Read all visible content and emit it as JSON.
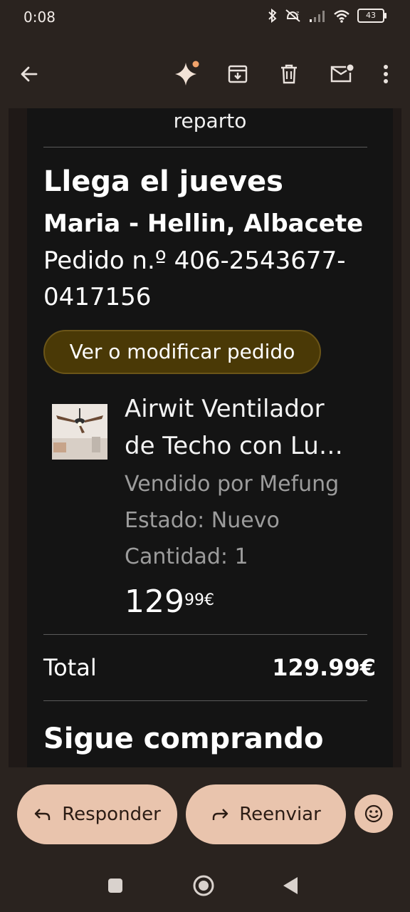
{
  "status_bar": {
    "time": "0:08",
    "battery": "43",
    "icons": [
      "bluetooth-icon",
      "dnd-icon",
      "signal-icon",
      "wifi-icon",
      "battery-icon"
    ]
  },
  "toolbar": {
    "icons": [
      "back-arrow-icon",
      "sparkle-icon",
      "archive-icon",
      "delete-icon",
      "mark-unread-icon",
      "more-vert-icon"
    ]
  },
  "email": {
    "reparto_text": "reparto",
    "arrival": "Llega el jueves",
    "recipient": "Maria - Hellin, Albacete",
    "order_line1": "Pedido n.º 406-2543677-",
    "order_line2": "0417156",
    "view_order_button": "Ver o modificar pedido",
    "product": {
      "title_line1": "Airwit Ventilador",
      "title_line2": "de Techo con Lu…",
      "seller": "Vendido por Mefung",
      "condition": "Estado: Nuevo",
      "quantity": "Cantidad: 1",
      "price_main": "129",
      "price_sup": "99€"
    },
    "total_label": "Total",
    "total_value": "129.99€",
    "keep_shopping": "Sigue comprando"
  },
  "actions": {
    "reply": "Responder",
    "forward": "Reenviar"
  },
  "colors": {
    "background": "#2a231f",
    "email_bg": "#141414",
    "pill_bg": "#4a3906",
    "action_bg": "#e9c4ad",
    "accent_dot": "#f2a36b"
  }
}
